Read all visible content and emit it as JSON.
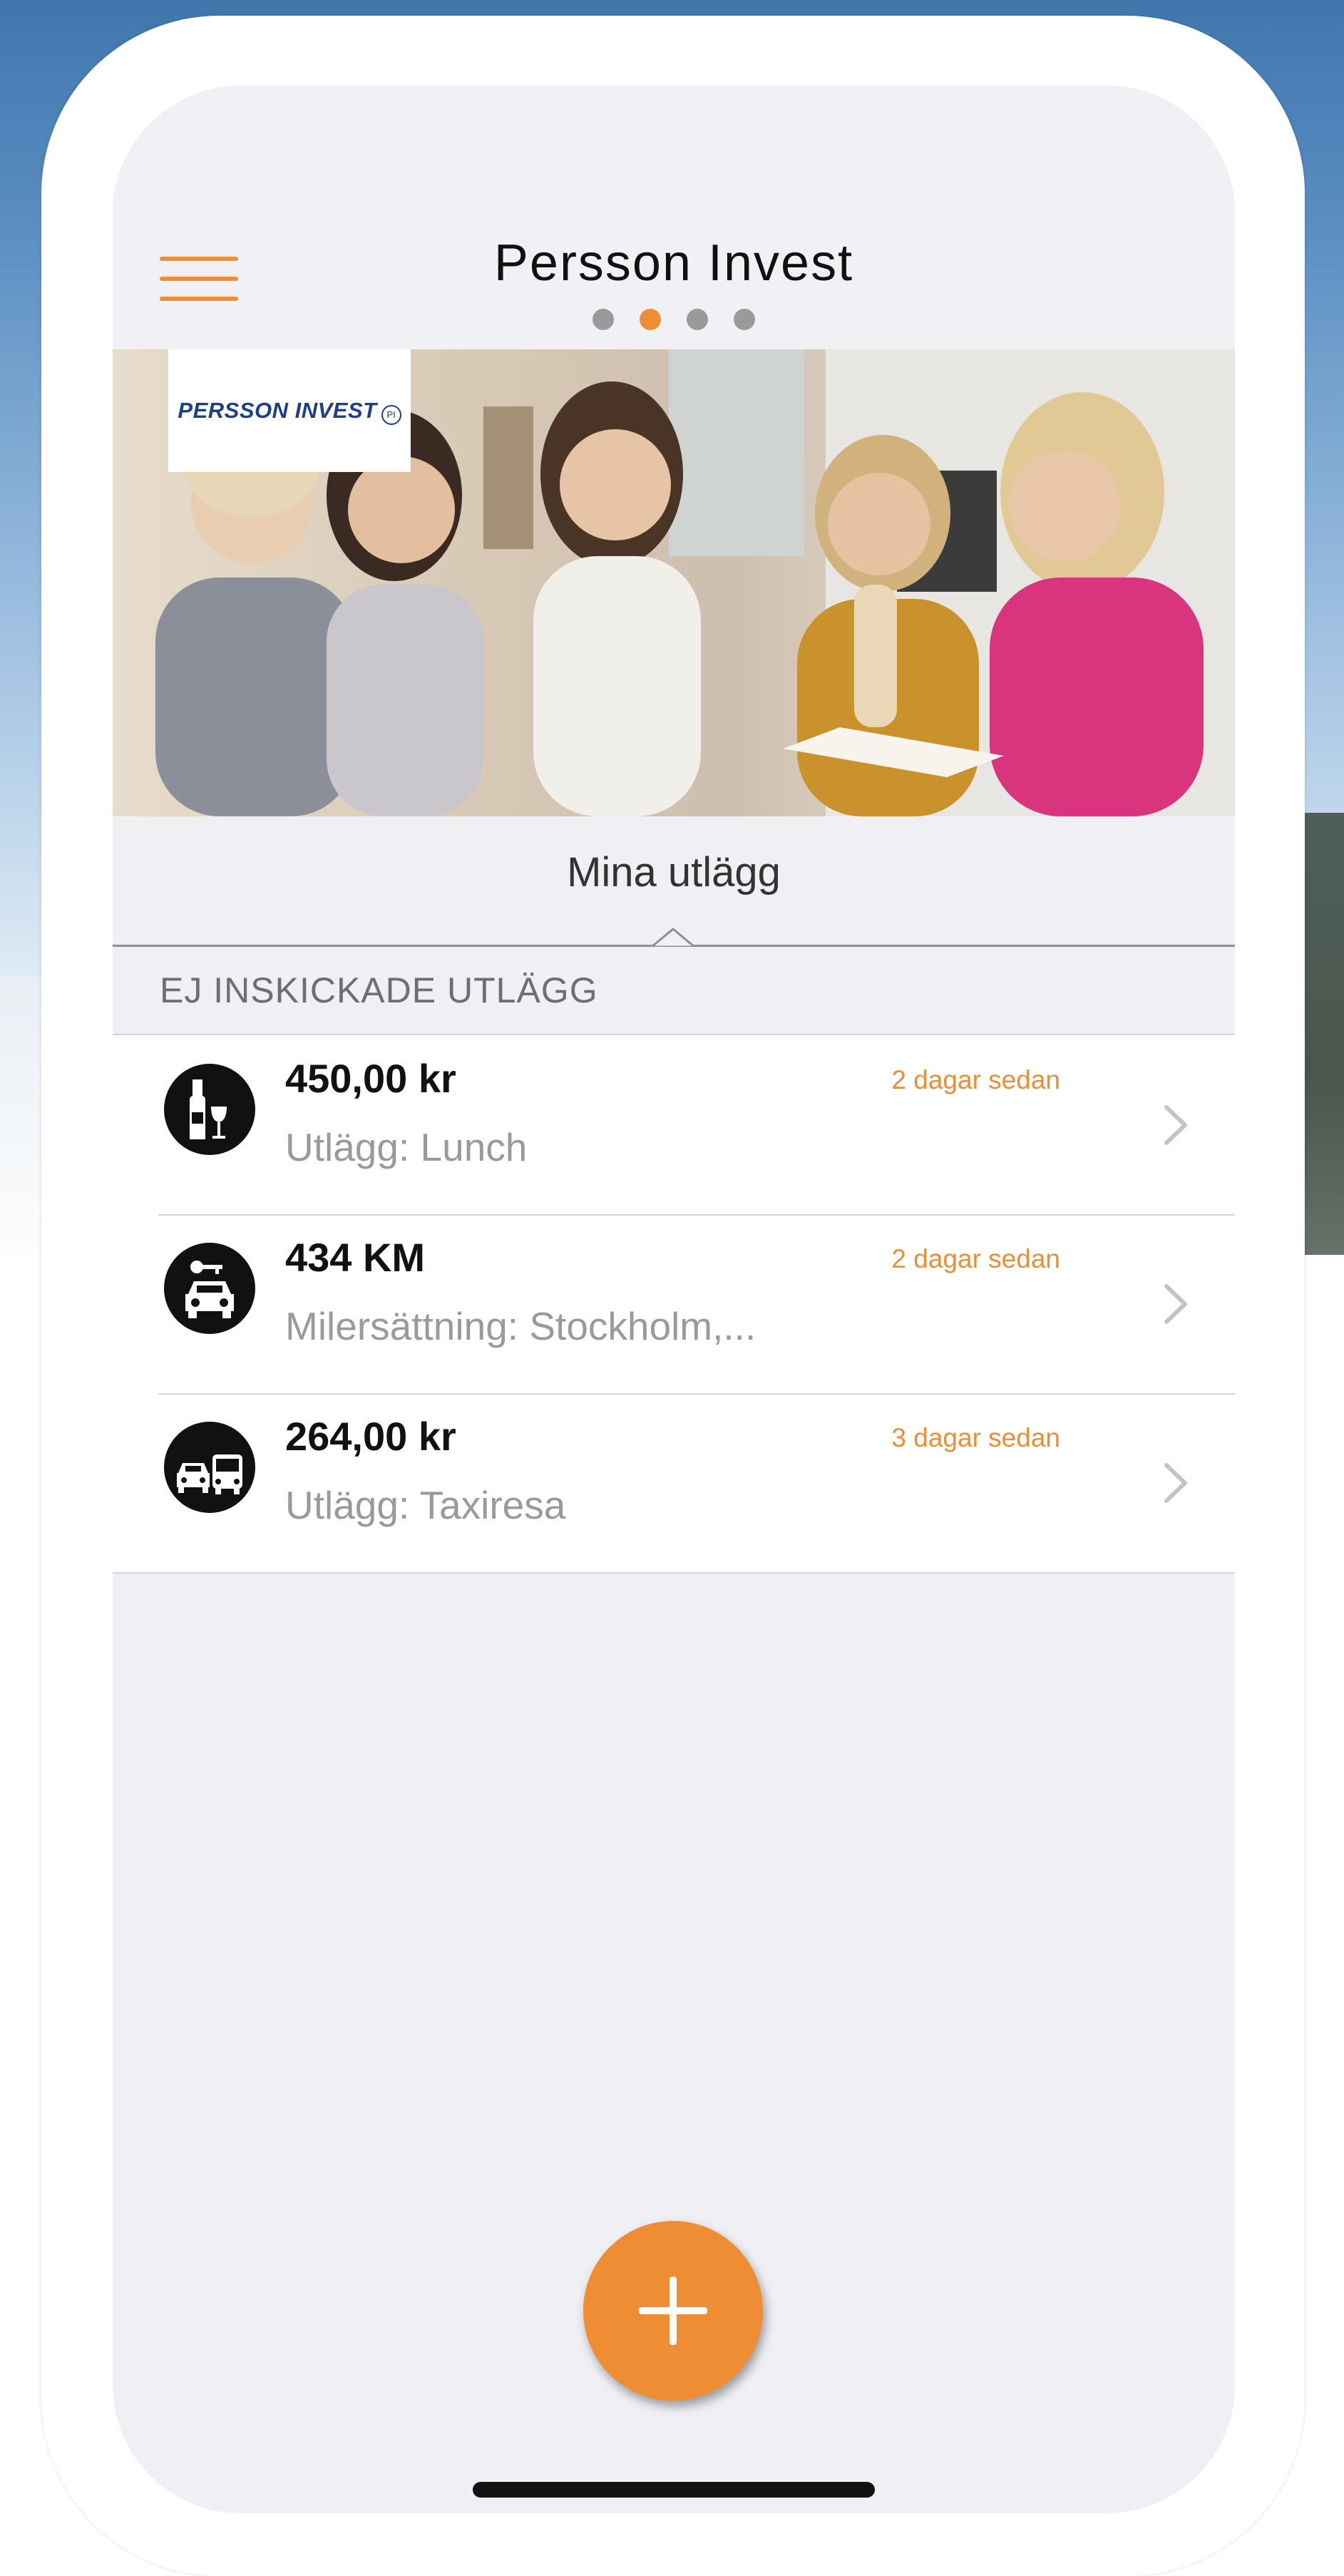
{
  "app": {
    "title": "Persson Invest",
    "accent_color": "#ee8d33",
    "menu_icon": "hamburger-menu-icon"
  },
  "pager": {
    "page_count": 4,
    "active_page": 2
  },
  "hero": {
    "logo_text": "PERSSON INVEST",
    "logo_mark": "PI"
  },
  "section": {
    "title": "Mina utlägg",
    "group_header": "EJ INSKICKADE UTLÄGG"
  },
  "expenses": [
    {
      "icon": "wine-bottle-icon",
      "amount": "450,00 kr",
      "description": "Utlägg: Lunch",
      "time": "2 dagar sedan"
    },
    {
      "icon": "car-key-icon",
      "amount": "434 KM",
      "description": "Milersättning: Stockholm,...",
      "time": "2 dagar sedan"
    },
    {
      "icon": "car-bus-icon",
      "amount": "264,00 kr",
      "description": "Utlägg: Taxiresa",
      "time": "3 dagar sedan"
    }
  ],
  "fab": {
    "icon": "plus-icon"
  }
}
